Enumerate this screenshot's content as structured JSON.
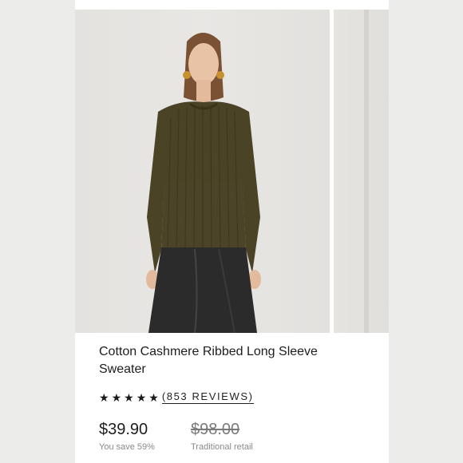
{
  "product": {
    "title": "Cotton Cashmere Ribbed Long Sleeve Sweater",
    "rating_stars": 5,
    "reviews_label": "(853 REVIEWS)",
    "sale_price": "$39.90",
    "savings_note": "You save 59%",
    "retail_price": "$98.00",
    "retail_label": "Traditional retail"
  },
  "icons": {
    "star": "star-icon"
  },
  "colors": {
    "sweater": "#4a4326",
    "pants": "#2b2b2b",
    "background": "#ececea"
  }
}
